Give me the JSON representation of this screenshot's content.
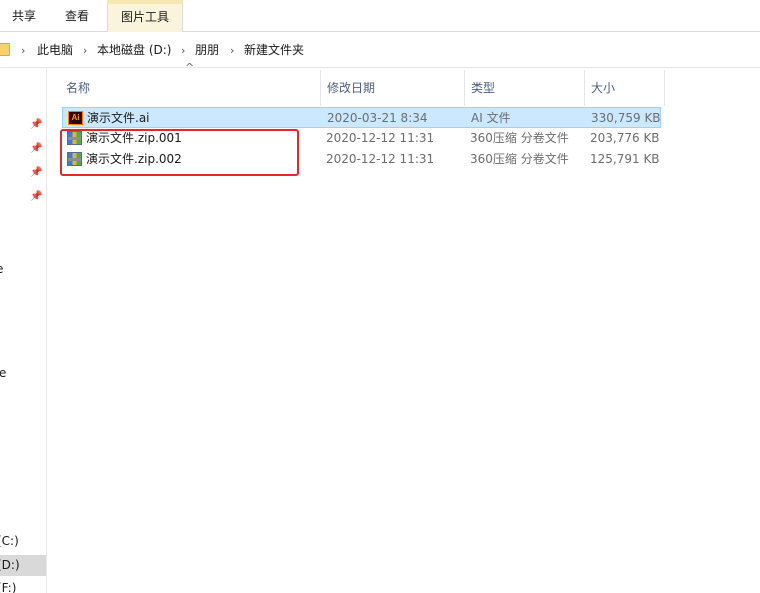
{
  "ribbon": {
    "tabs": [
      {
        "label": "共享"
      },
      {
        "label": "查看"
      },
      {
        "label": "图片工具"
      }
    ]
  },
  "address": {
    "crumbs": [
      "此电脑",
      "本地磁盘 (D:)",
      "朋朋",
      "新建文件夹"
    ]
  },
  "nav": {
    "partial_labels": [
      "е",
      "e",
      "(C:)",
      "(D:)",
      "(F:)"
    ]
  },
  "columns": {
    "name": "名称",
    "date": "修改日期",
    "type": "类型",
    "size": "大小"
  },
  "files": [
    {
      "name": "演示文件.ai",
      "date": "2020-03-21 8:34",
      "type": "AI 文件",
      "size": "330,759 KB",
      "icon": "illustrator-file-icon",
      "selected": true
    },
    {
      "name": "演示文件.zip.001",
      "date": "2020-12-12 11:31",
      "type": "360压缩 分卷文件",
      "size": "203,776 KB",
      "icon": "archive-volume-icon",
      "selected": false
    },
    {
      "name": "演示文件.zip.002",
      "date": "2020-12-12 11:31",
      "type": "360压缩 分卷文件",
      "size": "125,791 KB",
      "icon": "archive-volume-icon",
      "selected": false
    }
  ],
  "colors": {
    "selection_bg": "#cce8ff",
    "selection_border": "#99d1ff",
    "highlight": "#e0282d",
    "active_tab": "#fbf4dc"
  }
}
